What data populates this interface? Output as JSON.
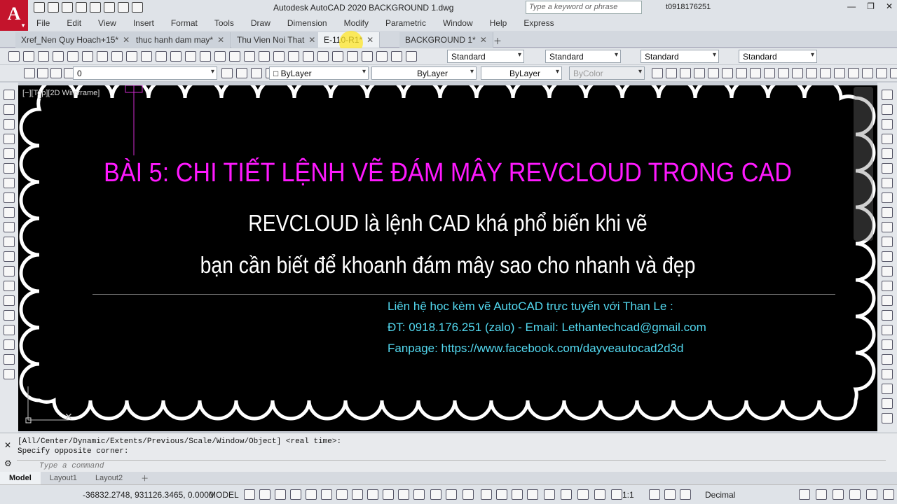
{
  "app": {
    "logo": "A",
    "title": "Autodesk AutoCAD 2020    BACKGROUND 1.dwg",
    "search_placeholder": "Type a keyword or phrase",
    "user": "t0918176251"
  },
  "menu": [
    "File",
    "Edit",
    "View",
    "Insert",
    "Format",
    "Tools",
    "Draw",
    "Dimension",
    "Modify",
    "Parametric",
    "Window",
    "Help",
    "Express"
  ],
  "tabs": [
    {
      "label": "Xref_Nen Quy Hoach+15*"
    },
    {
      "label": "thuc hanh dam may*"
    },
    {
      "label": "Thu Vien Noi That"
    },
    {
      "label": "E-110-R1*"
    },
    {
      "label": "BACKGROUND 1*"
    }
  ],
  "styles_toolbar": {
    "text_style": "Standard",
    "dim_style": "Standard",
    "table_style": "Standard",
    "mleader_style": "Standard"
  },
  "layers_toolbar": {
    "layer": "0",
    "color": "ByLayer",
    "linetype": "ByLayer",
    "lineweight": "ByLayer",
    "plotstyle": "ByColor"
  },
  "viewport": {
    "label": "[−][Top][2D Wireframe]"
  },
  "slide": {
    "title": "BÀI 5: CHI TIẾT LỆNH VẼ ĐÁM MÂY REVCLOUD TRONG CAD",
    "line1": "REVCLOUD là lệnh CAD khá phổ biến khi vẽ",
    "line2": "bạn cần biết để khoanh đám mây sao cho nhanh và đẹp",
    "contact1": "Liên hệ học kèm vẽ AutoCAD trực tuyến với Than Le :",
    "contact2": "ĐT: 0918.176.251 (zalo)  - Email: Lethantechcad@gmail.com",
    "contact3": "Fanpage:  https://www.facebook.com/dayveautocad2d3d"
  },
  "command": {
    "history1": "[All/Center/Dynamic/Extents/Previous/Scale/Window/Object] <real time>:",
    "history2": "Specify opposite corner:",
    "placeholder": "Type a command"
  },
  "layouts": [
    "Model",
    "Layout1",
    "Layout2"
  ],
  "status": {
    "coords": "-36832.2748, 931126.3465, 0.0000",
    "space": "MODEL",
    "scale": "1:1",
    "units": "Decimal"
  },
  "colors": {
    "title": "#ff19ff",
    "contact": "#53d9f0",
    "canvas": "#000000",
    "brand": "#c4142c"
  }
}
